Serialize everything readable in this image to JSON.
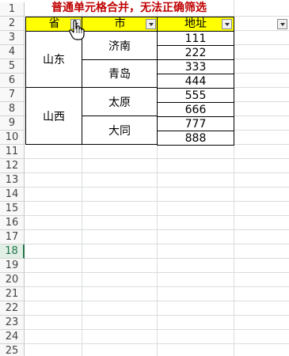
{
  "sheet": {
    "row_numbers": [
      "1",
      "2",
      "3",
      "4",
      "5",
      "6",
      "7",
      "8",
      "9",
      "10",
      "11",
      "12",
      "13",
      "14",
      "15",
      "16",
      "17",
      "18",
      "19",
      "20",
      "21",
      "22",
      "23",
      "24",
      "25"
    ],
    "active_row": "18",
    "title": "普通单元格合并，无法正确筛选",
    "title_color": "#c00000",
    "header_fill": "#ffff00",
    "headers": {
      "province": "省",
      "city": "市",
      "address": "地址"
    },
    "provinces": [
      "山东",
      "山西"
    ],
    "cities": [
      "济南",
      "青岛",
      "太原",
      "大同"
    ],
    "addresses": [
      "111",
      "222",
      "333",
      "444",
      "555",
      "666",
      "777",
      "888"
    ]
  },
  "icons": {
    "filter_dropdown": "chevron-down-icon",
    "cursor": "hand-pointer-icon"
  }
}
